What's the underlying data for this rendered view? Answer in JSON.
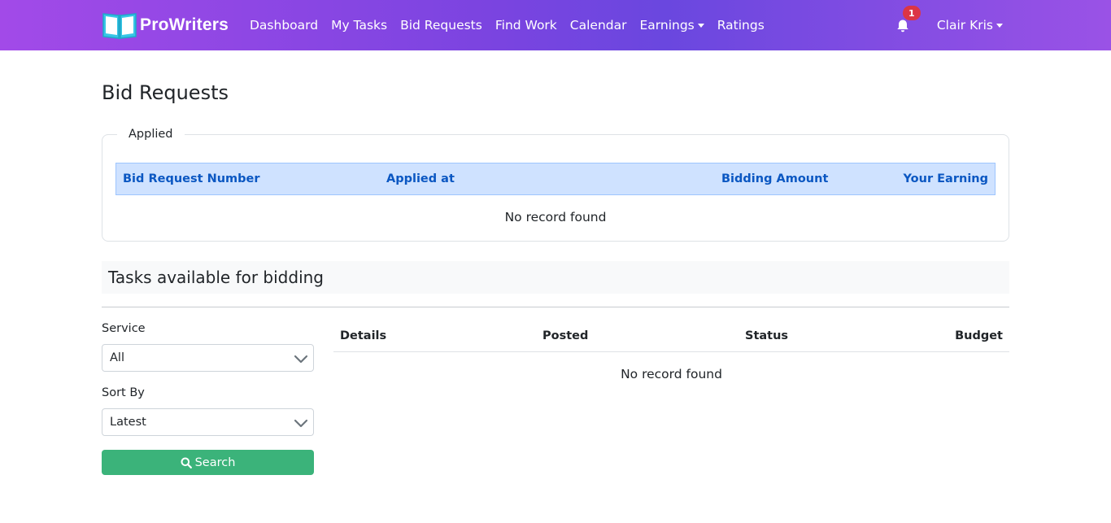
{
  "navbar": {
    "brand": "ProWriters",
    "links": [
      "Dashboard",
      "My Tasks",
      "Bid Requests",
      "Find Work",
      "Calendar",
      "Earnings",
      "Ratings"
    ],
    "notification_count": "1",
    "user_name": "Clair Kris"
  },
  "page": {
    "title": "Bid Requests"
  },
  "applied": {
    "legend": "Applied",
    "columns": [
      "Bid Request Number",
      "Applied at",
      "Bidding Amount",
      "Your Earning"
    ],
    "empty_text": "No record found"
  },
  "tasks": {
    "header": "Tasks available for bidding",
    "filters": {
      "service_label": "Service",
      "service_value": "All",
      "sort_label": "Sort By",
      "sort_value": "Latest",
      "search_label": "Search"
    },
    "columns": [
      "Details",
      "Posted",
      "Status",
      "Budget"
    ],
    "empty_text": "No record found"
  },
  "colors": {
    "accent_purple": "#7a44e0",
    "search_green": "#3bb37a",
    "table_head_blue": "#cfe2ff",
    "badge_red": "#dc3545"
  }
}
